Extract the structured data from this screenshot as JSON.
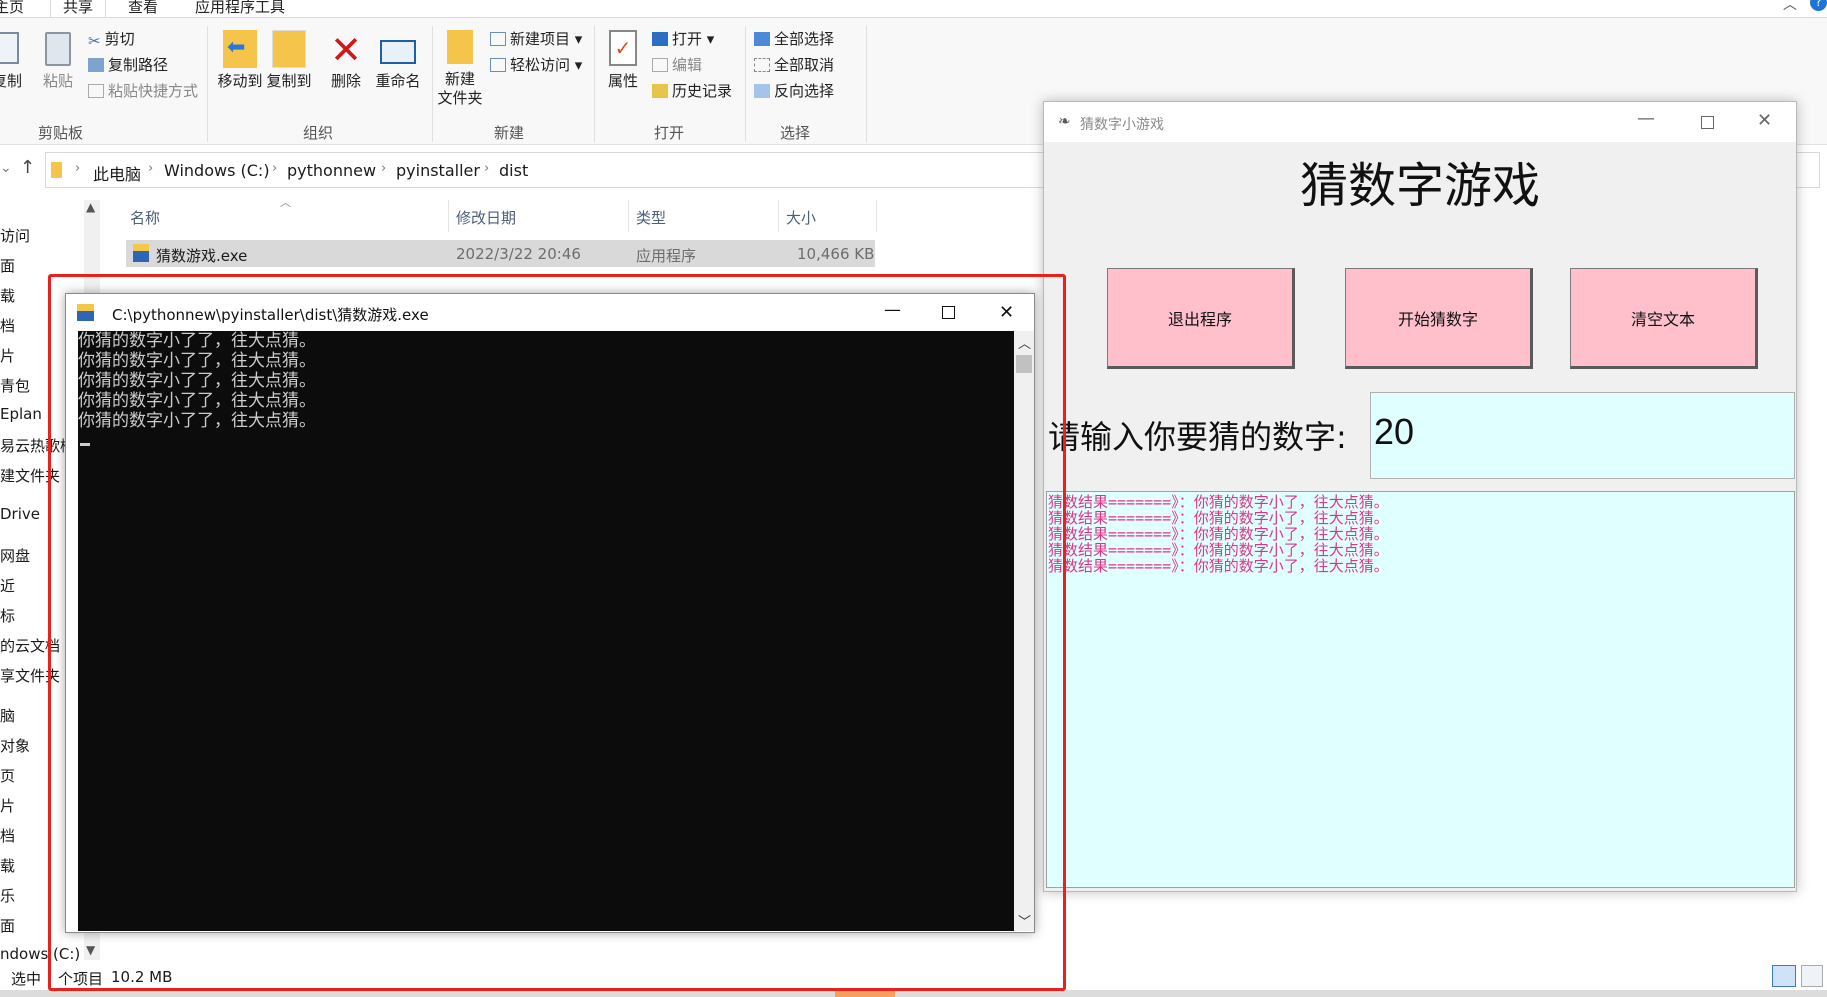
{
  "explorer": {
    "tabs": [
      "主页",
      "共享",
      "查看",
      "应用程序工具"
    ],
    "clipboard": {
      "copy": "复制",
      "paste": "粘贴",
      "cut": "剪切",
      "copy_path": "复制路径",
      "paste_shortcut": "粘贴快捷方式",
      "group": "剪贴板"
    },
    "organize": {
      "move_to": "移动到",
      "copy_to": "复制到",
      "delete": "删除",
      "rename": "重命名",
      "group": "组织"
    },
    "new": {
      "new_folder_l1": "新建",
      "new_folder_l2": "文件夹",
      "new_item": "新建项目",
      "easy_access": "轻松访问",
      "group": "新建"
    },
    "open": {
      "properties": "属性",
      "open": "打开",
      "edit": "编辑",
      "history": "历史记录",
      "group": "打开"
    },
    "select": {
      "select_all": "全部选择",
      "select_none": "全部取消",
      "invert": "反向选择",
      "group": "选择"
    },
    "breadcrumb": [
      "此电脑",
      "Windows (C:)",
      "pythonnew",
      "pyinstaller",
      "dist"
    ],
    "nav_items": [
      "访问",
      "面",
      "载",
      "档",
      "片",
      "青包",
      "Eplan",
      "易云热歌榜",
      "建文件夹",
      "Drive",
      "网盘",
      "近",
      "标",
      "的云文档",
      "享文件夹",
      "脑",
      "对象",
      "页",
      "片",
      "档",
      "载",
      "乐",
      "面",
      "ndows (C:)"
    ],
    "columns": {
      "name": "名称",
      "date": "修改日期",
      "type": "类型",
      "size": "大小"
    },
    "file": {
      "name": "猜数游戏.exe",
      "date": "2022/3/22 20:46",
      "type": "应用程序",
      "size": "10,466 KB"
    },
    "status": {
      "selected": "选中",
      "count": "个项目",
      "size": "10.2 MB"
    }
  },
  "console": {
    "title": "C:\\pythonnew\\pyinstaller\\dist\\猜数游戏.exe",
    "lines": [
      "你猜的数字小了了，往大点猜。",
      "你猜的数字小了了，往大点猜。",
      "你猜的数字小了了，往大点猜。",
      "你猜的数字小了了，往大点猜。",
      "你猜的数字小了了，往大点猜。"
    ]
  },
  "game": {
    "title": "猜数字小游戏",
    "heading": "猜数字游戏",
    "buttons": {
      "exit": "退出程序",
      "start": "开始猜数字",
      "clear": "清空文本"
    },
    "prompt": "请输入你要猜的数字:",
    "entry_value": "20",
    "results": [
      "猜数结果=======》：你猜的数字小了，往大点猜。",
      "猜数结果=======》：你猜的数字小了，往大点猜。",
      "猜数结果=======》：你猜的数字小了，往大点猜。",
      "猜数结果=======》：你猜的数字小了，往大点猜。",
      "猜数结果=======》：你猜的数字小了，往大点猜。"
    ]
  },
  "colors": {
    "highlight": "#e8211c",
    "game_button": "#ffc0cb",
    "entry_bg": "#e0ffff",
    "result_text": "#e0348a",
    "console_bg": "#0c0c0c"
  }
}
